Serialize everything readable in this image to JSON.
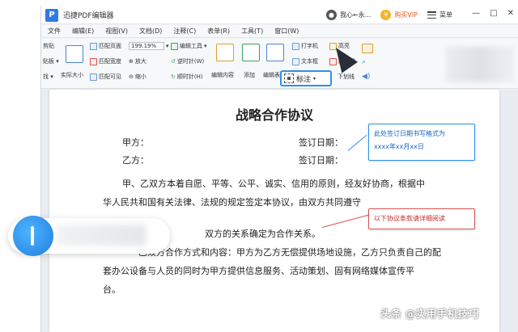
{
  "app": {
    "logo_letter": "P",
    "title": "迅捷PDF编辑器",
    "user_name": "我心←永...",
    "vip_label": "购买VIP",
    "menu_label": "菜单"
  },
  "window_controls": [
    "—",
    "□",
    "✕"
  ],
  "menu": [
    "文件",
    "编辑(E)",
    "视图(V)",
    "文档(D)",
    "注释(C)",
    "表单(R)",
    "工具(T)",
    "窗口(W)"
  ],
  "toolbar": {
    "left_col": [
      "剪贴",
      "贴板 ▾",
      "找 ▾"
    ],
    "actual_size": "实际大小",
    "fit_page": "匹配页面",
    "fit_width": "匹配宽度",
    "fit_visible": "匹配可见",
    "zoom_value": "199.19%",
    "zoom_in": "放大",
    "zoom_out": "缩小",
    "edit_tool": "编辑工具",
    "rotate_left": "逆时针(W)",
    "rotate_right": "顺时针(H)",
    "edit_content": "编辑内容",
    "add": "添加",
    "edit_form": "编辑表",
    "typewriter": "打字机",
    "textbox": "文本框",
    "highlight": "高亮",
    "strikeout": "删除线",
    "underline": "下划线",
    "annotation": "标注"
  },
  "document": {
    "title": "战略合作协议",
    "party_a": "甲方：",
    "party_b": "乙方：",
    "sign_date_1": "签订日期：",
    "sign_date_2": "签订日期：",
    "para1_line1": "甲、乙双方本着自愿、平等、公平、诚实、信用的原则，经友好协商，根据中",
    "para1_line2": "华人民共和国有关法律、法规的规定签定本协议，由双方共同遵守",
    "para2_line1": "双方的关系确定为合作关系。",
    "para3_line1": "乙双方合作方式和内容：甲方为乙方无偿提供场地设施，乙方只负责自己的配",
    "para3_line2": "套办公设备与人员的同时为甲方提供信息服务、活动策划、固有网络媒体宣传平",
    "para3_line3": "台。"
  },
  "callouts": {
    "blue_line1": "此处签订日期书写格式为",
    "blue_line2": "xxxx年xx月xx日",
    "red_text": "以下协议条款请详细阅读"
  },
  "watermark": "头条 @实用手机技巧",
  "colors": {
    "accent_blue": "#2d8ff0",
    "callout_red": "#d9534f",
    "vip_orange": "#e05a1e"
  }
}
